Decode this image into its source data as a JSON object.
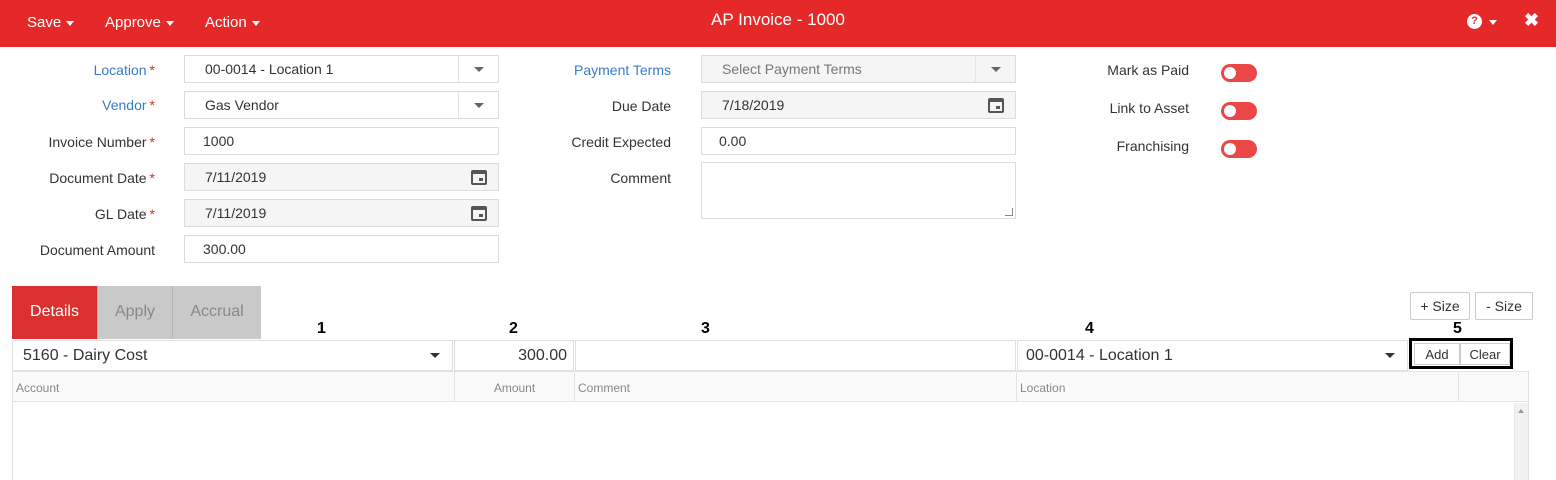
{
  "topbar": {
    "menus": [
      "Save",
      "Approve",
      "Action"
    ],
    "title": "AP Invoice - 1000"
  },
  "form": {
    "location": {
      "label": "Location",
      "value": "00-0014 - Location 1"
    },
    "vendor": {
      "label": "Vendor",
      "value": "Gas Vendor"
    },
    "invoice_number": {
      "label": "Invoice Number",
      "value": "1000"
    },
    "document_date": {
      "label": "Document Date",
      "value": "7/11/2019"
    },
    "gl_date": {
      "label": "GL Date",
      "value": "7/11/2019"
    },
    "document_amount": {
      "label": "Document Amount",
      "value": "300.00"
    },
    "payment_terms": {
      "label": "Payment Terms",
      "placeholder": "Select Payment Terms"
    },
    "due_date": {
      "label": "Due Date",
      "value": "7/18/2019"
    },
    "credit_expected": {
      "label": "Credit Expected",
      "value": "0.00"
    },
    "comment": {
      "label": "Comment",
      "value": ""
    },
    "required_mark": "*"
  },
  "toggles": [
    {
      "label": "Mark as Paid",
      "on": false
    },
    {
      "label": "Link to Asset",
      "on": false
    },
    {
      "label": "Franchising",
      "on": false
    }
  ],
  "tabs": [
    "Details",
    "Apply",
    "Accrual"
  ],
  "size_buttons": {
    "increase": "+ Size",
    "decrease": "- Size"
  },
  "annotations": [
    "1",
    "2",
    "3",
    "4",
    "5"
  ],
  "entry_row": {
    "account": "5160 - Dairy Cost",
    "amount": "300.00",
    "comment": "",
    "location": "00-0014 - Location 1",
    "add_label": "Add",
    "clear_label": "Clear"
  },
  "grid": {
    "columns": [
      "Account",
      "Amount",
      "Comment",
      "Location"
    ]
  },
  "colors": {
    "brand": "#e52929",
    "link": "#3a7bc8",
    "toggle_off": "#ec4747"
  }
}
